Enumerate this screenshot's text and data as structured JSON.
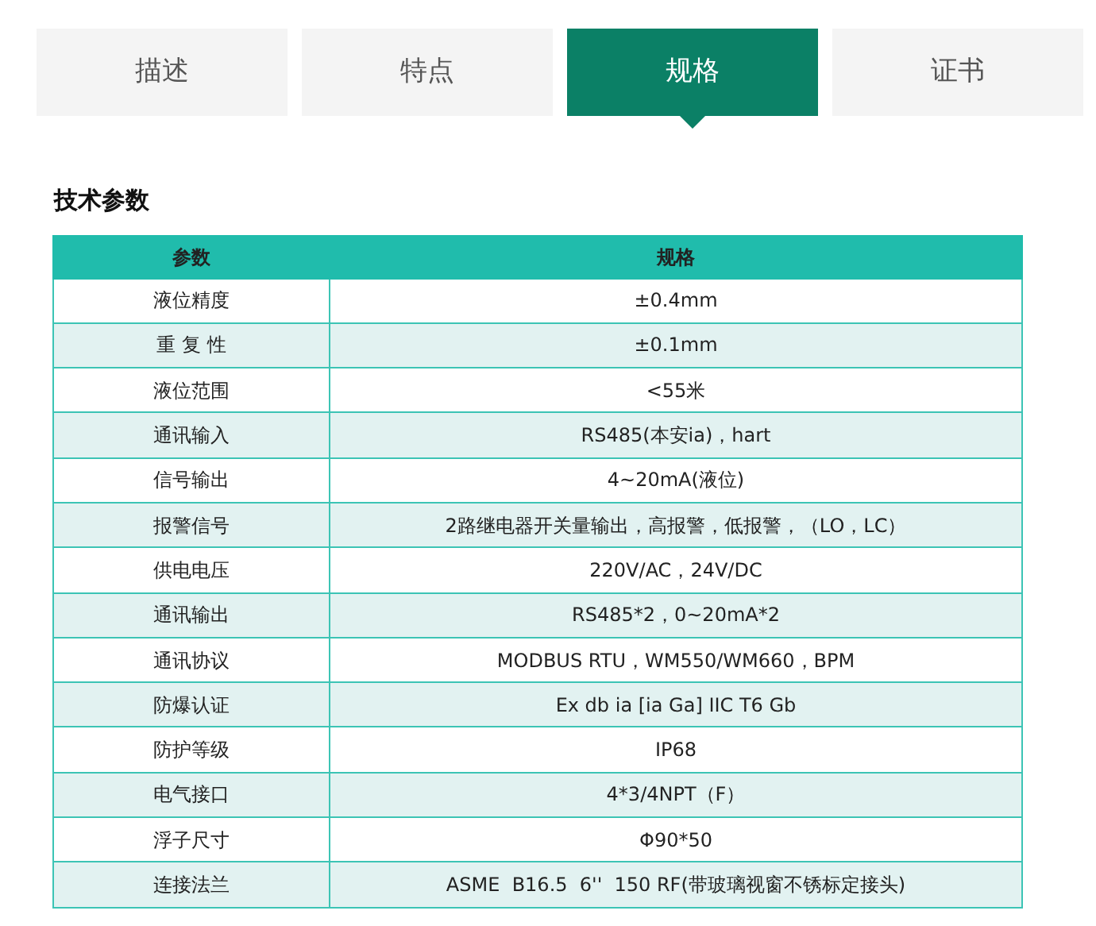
{
  "tabs": [
    {
      "label": "描述",
      "selected": false
    },
    {
      "label": "特点",
      "selected": false
    },
    {
      "label": "规格",
      "selected": true
    },
    {
      "label": "证书",
      "selected": false
    }
  ],
  "section_title": "技术参数",
  "table": {
    "columns": [
      "参数",
      "规格"
    ],
    "rows": [
      [
        "液位精度",
        "±0.4mm"
      ],
      [
        "重 复 性",
        "±0.1mm"
      ],
      [
        "液位范围",
        "<55米"
      ],
      [
        "通讯输入",
        "RS485(本安ia)，hart"
      ],
      [
        "信号输出",
        "4~20mA(液位)"
      ],
      [
        "报警信号",
        "2路继电器开关量输出，高报警，低报警，（LO，LC）"
      ],
      [
        "供电电压",
        "220V/AC，24V/DC"
      ],
      [
        "通讯输出",
        "RS485*2，0~20mA*2"
      ],
      [
        "通讯协议",
        "MODBUS RTU，WM550/WM660，BPM"
      ],
      [
        "防爆认证",
        "Ex db ia [ia Ga] IIC T6 Gb"
      ],
      [
        "防护等级",
        "IP68"
      ],
      [
        "电气接口",
        "4*3/4NPT（F）"
      ],
      [
        "浮子尺寸",
        "Φ90*50"
      ],
      [
        "连接法兰",
        "ASME  B16.5  6''  150 RF(带玻璃视窗不锈标定接头)"
      ]
    ]
  }
}
